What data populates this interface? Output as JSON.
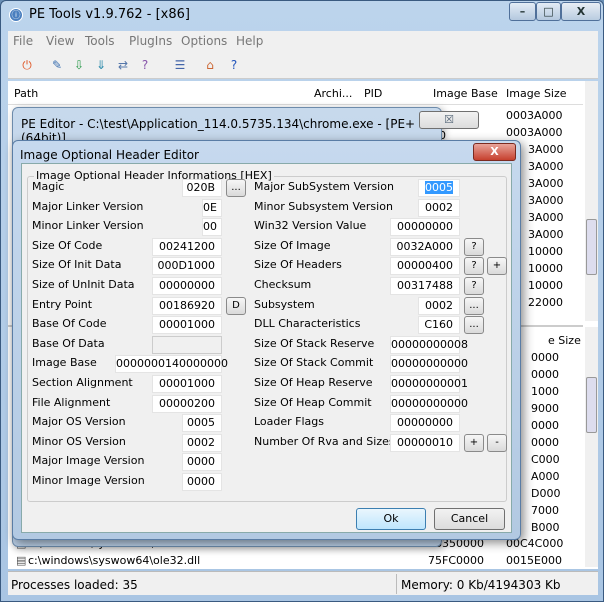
{
  "app": {
    "title": "PE Tools v1.9.762 - [x86]",
    "minimize": "–",
    "maximize": "□",
    "close": "X"
  },
  "menu": [
    "File",
    "View",
    "Tools",
    "PlugIns",
    "Options",
    "Help"
  ],
  "toolbar": {
    "icons": [
      "power-icon",
      "edit-pe-icon",
      "dump-icon",
      "dump-full-icon",
      "rebuild-icon",
      "break-icon",
      "options-list-icon",
      "home-icon",
      "help-icon"
    ]
  },
  "list": {
    "columns": [
      "Path",
      "Archi...",
      "PID",
      "Image Base",
      "Image Size"
    ],
    "top_image_base": [
      "00",
      "00"
    ],
    "top_image_size": [
      "0003A000",
      "0003A000",
      "3A000",
      "3A000",
      "3A000",
      "3A000",
      "3A000",
      "3A000",
      "10000",
      "10000",
      "10000",
      "22000"
    ],
    "lower_header": "e Size",
    "lower_image_size": [
      "0000",
      "0000",
      "1000",
      "9000",
      "0000",
      "0000",
      "C000",
      "A000",
      "D000",
      "7000",
      "B000"
    ],
    "rows": [
      {
        "path": "c:\\windows\\syswow64\\shell32.dll",
        "base": "76350000",
        "size": "00C4C000"
      },
      {
        "path": "c:\\windows\\syswow64\\ole32.dll",
        "base": "75FC0000",
        "size": "0015E000"
      }
    ]
  },
  "status": {
    "processes": "Processes loaded: 35",
    "memory": "Memory: 0 Kb/4194303 Kb"
  },
  "pe_editor": {
    "title": "PE Editor - C:\\test\\Application_114.0.5735.134\\chrome.exe - [PE+(64bit)]",
    "close": "☒"
  },
  "dialog": {
    "title": "Image Optional Header Editor",
    "close": "X",
    "group": "Image Optional Header Informations [HEX]",
    "left": [
      {
        "label": "Magic",
        "value": "020B",
        "w": 40,
        "btn": "..."
      },
      {
        "label": "Major Linker Version",
        "value": "0E",
        "w": 20
      },
      {
        "label": "Minor Linker Version",
        "value": "00",
        "w": 20
      },
      {
        "label": "Size Of Code",
        "value": "00241200",
        "w": 70
      },
      {
        "label": "Size Of Init Data",
        "value": "000D1000",
        "w": 70
      },
      {
        "label": "Size of UnInit Data",
        "value": "00000000",
        "w": 70
      },
      {
        "label": "Entry Point",
        "value": "00186920",
        "w": 70,
        "btn": "D"
      },
      {
        "label": "Base Of Code",
        "value": "00001000",
        "w": 70
      },
      {
        "label": "Base Of Data",
        "value": "",
        "w": 70,
        "disabled": true
      },
      {
        "label": "Image Base",
        "value": "0000000140000000",
        "w": 107
      },
      {
        "label": "Section Alignment",
        "value": "00001000",
        "w": 70
      },
      {
        "label": "File Alignment",
        "value": "00000200",
        "w": 70
      },
      {
        "label": "Major OS Version",
        "value": "0005",
        "w": 40
      },
      {
        "label": "Minor OS Version",
        "value": "0002",
        "w": 40
      },
      {
        "label": "Major Image Version",
        "value": "0000",
        "w": 40
      },
      {
        "label": "Minor Image Version",
        "value": "0000",
        "w": 40
      }
    ],
    "right": [
      {
        "label": "Major SubSystem Version",
        "value": "0005",
        "w": 42,
        "selected": true
      },
      {
        "label": "Minor Subsystem Version",
        "value": "0002",
        "w": 42
      },
      {
        "label": "Win32 Version Value",
        "value": "00000000",
        "w": 70
      },
      {
        "label": "Size Of Image",
        "value": "0032A000",
        "w": 70,
        "btn": "?"
      },
      {
        "label": "Size Of Headers",
        "value": "00000400",
        "w": 70,
        "btn": "?",
        "btn2": "+"
      },
      {
        "label": "Checksum",
        "value": "00317488",
        "w": 70,
        "btn": "?"
      },
      {
        "label": "Subsystem",
        "value": "0002",
        "w": 42,
        "btn": "..."
      },
      {
        "label": "DLL Characteristics",
        "value": "C160",
        "w": 42,
        "btn": "..."
      },
      {
        "label": "Size Of Stack Reserve",
        "value": "00000000008",
        "w": 70
      },
      {
        "label": "Size Of Stack Commit",
        "value": "00000000000",
        "w": 70
      },
      {
        "label": "Size Of Heap Reserve",
        "value": "00000000001",
        "w": 70
      },
      {
        "label": "Size Of Heap Commit",
        "value": "00000000000",
        "w": 70
      },
      {
        "label": "Loader Flags",
        "value": "00000000",
        "w": 70
      },
      {
        "label": "Number Of Rva and Sizes",
        "value": "00000010",
        "w": 70,
        "btn": "+",
        "btn2": "-"
      }
    ],
    "ok": "Ok",
    "cancel": "Cancel"
  }
}
